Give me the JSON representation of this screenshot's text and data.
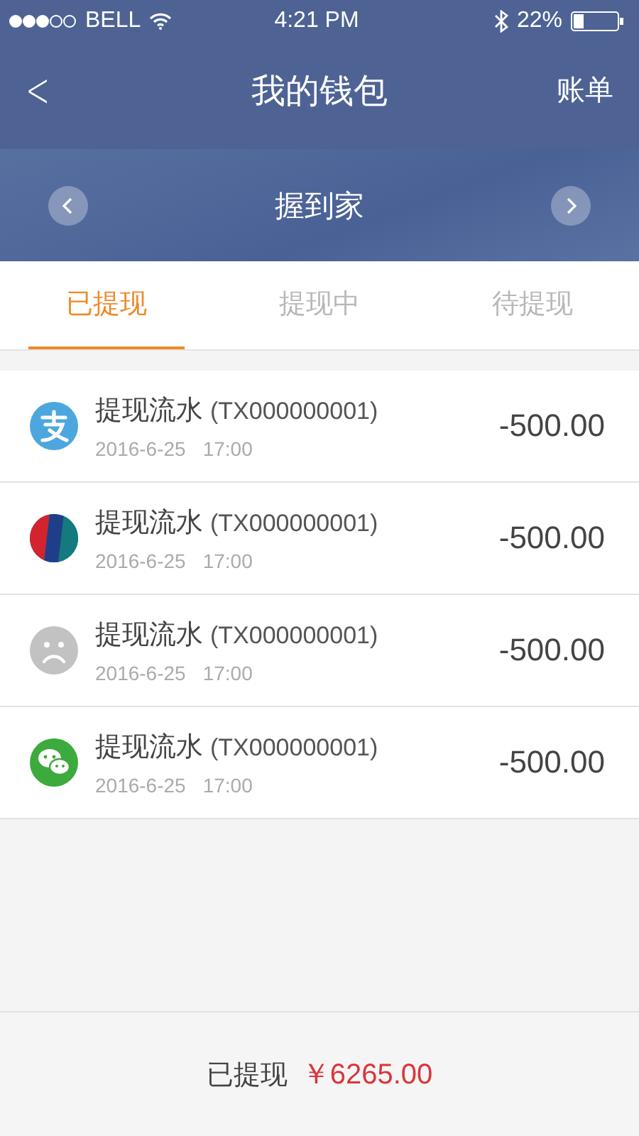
{
  "status_bar": {
    "carrier": "BELL",
    "time": "4:21 PM",
    "battery_text": "22%"
  },
  "nav": {
    "back": "<",
    "title": "我的钱包",
    "action": "账单"
  },
  "store": {
    "name": "握到家"
  },
  "tabs": [
    {
      "label": "已提现",
      "selected": true
    },
    {
      "label": "提现中",
      "selected": false
    },
    {
      "label": "待提现",
      "selected": false
    }
  ],
  "rows": [
    {
      "kind": "alipay",
      "title": "提现流水",
      "code": "(TX000000001)",
      "date": "2016-6-25",
      "time": "17:00",
      "amount": "-500.00"
    },
    {
      "kind": "unionpay",
      "title": "提现流水",
      "code": "(TX000000001)",
      "date": "2016-6-25",
      "time": "17:00",
      "amount": "-500.00"
    },
    {
      "kind": "unknown",
      "title": "提现流水",
      "code": "(TX000000001)",
      "date": "2016-6-25",
      "time": "17:00",
      "amount": "-500.00"
    },
    {
      "kind": "wechat",
      "title": "提现流水",
      "code": "(TX000000001)",
      "date": "2016-6-25",
      "time": "17:00",
      "amount": "-500.00"
    }
  ],
  "footer": {
    "label": "已提现",
    "total": "￥6265.00"
  }
}
